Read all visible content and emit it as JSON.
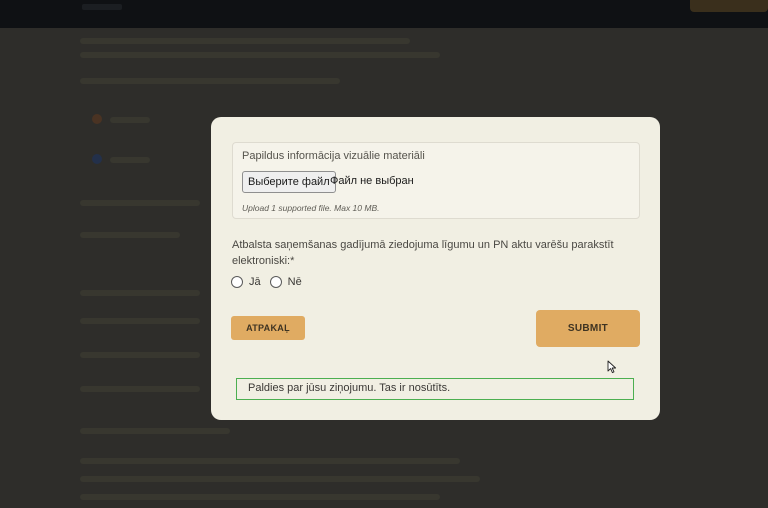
{
  "upload": {
    "label": "Papildus informācija vizuālie materiāli",
    "button_label": "Выберите файл",
    "status": "Файл не выбран",
    "hint": "Upload 1 supported file. Max 10 MB."
  },
  "question": {
    "text": "Atbalsta saņemšanas gadījumā ziedojuma līgumu un PN aktu varēšu parakstīt elektroniski:*",
    "options": [
      {
        "label": "Jā",
        "selected": false
      },
      {
        "label": "Nē",
        "selected": false
      }
    ]
  },
  "buttons": {
    "back": "ATPAKAĻ",
    "submit": "SUBMIT"
  },
  "message": {
    "text": "Paldies par jūsu ziņojumu. Tas ir nosūtīts."
  },
  "colors": {
    "accent": "#e0ab62",
    "success_border": "#4caf50",
    "modal_bg": "#f1efe3"
  }
}
